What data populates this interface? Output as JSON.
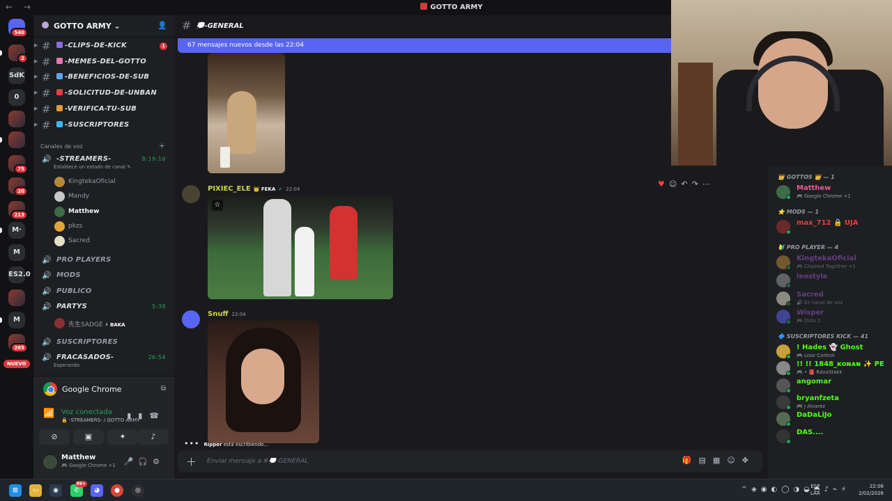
{
  "window": {
    "title": "GOTTO ARMY",
    "nav_arrows": "← →"
  },
  "server": {
    "name": "GOTTO ARMY",
    "invite_icon": "add-user-icon"
  },
  "rail": [
    {
      "label": "",
      "badge": "540",
      "icon": "discord-home-icon"
    },
    {
      "label": "",
      "badge": "2",
      "icon": "server-avatar"
    },
    {
      "label": "SdK",
      "badge": ""
    },
    {
      "label": "0",
      "badge": ""
    },
    {
      "label": "",
      "badge": "",
      "icon": "server-avatar"
    },
    {
      "label": "",
      "badge": "",
      "icon": "server-avatar"
    },
    {
      "label": "",
      "badge": "75",
      "icon": "server-avatar"
    },
    {
      "label": "",
      "badge": "20",
      "icon": "server-avatar"
    },
    {
      "label": "",
      "badge": "213",
      "icon": "server-avatar"
    },
    {
      "label": "M·",
      "badge": ""
    },
    {
      "label": "M",
      "badge": ""
    },
    {
      "label": "ES2.0",
      "badge": ""
    },
    {
      "label": "",
      "badge": "",
      "icon": "server-avatar"
    },
    {
      "label": "M",
      "badge": ""
    },
    {
      "label": "",
      "badge": "265",
      "icon": "server-avatar"
    }
  ],
  "rail_new_label": "NUEVO",
  "text_channels": [
    {
      "name": "-CLIPS-DE-KICK",
      "emoji_color": "#8a6ed8",
      "unread": "1"
    },
    {
      "name": "-MEMES-DEL-GOTTO",
      "emoji_color": "#e07ab0",
      "unread": ""
    },
    {
      "name": "-BENEFICIOS-DE-SUB",
      "emoji_color": "#5fa8e8",
      "unread": ""
    },
    {
      "name": "-SOLICITUD-DE-UNBAN",
      "emoji_color": "#e0413e",
      "unread": ""
    },
    {
      "name": "-VERIFICA-TU-SUB",
      "emoji_color": "#e39a3b",
      "unread": ""
    },
    {
      "name": "-SUSCRIPTORES",
      "emoji_color": "#3fb6e8",
      "unread": ""
    }
  ],
  "voice_category": "Canales de voz",
  "voice_channels": [
    {
      "name": "-STREAMERS-",
      "time": "8:19:16",
      "sub": "Establece un estado de canal ✎",
      "active": true
    },
    {
      "name": "PRO PLAYERS",
      "time": "",
      "sub": "",
      "active": false
    },
    {
      "name": "MODS",
      "time": "",
      "sub": "",
      "active": false
    },
    {
      "name": "PUBLICO",
      "time": "",
      "sub": "",
      "active": false
    },
    {
      "name": "PARTYS",
      "time": "5:38",
      "sub": "",
      "active": true
    },
    {
      "name": "SUSCRIPTORES",
      "time": "",
      "sub": "",
      "active": false
    },
    {
      "name": "FRACASADOS-",
      "time": "26:54",
      "sub": "Esperando",
      "active": true
    }
  ],
  "voice_members_streamers": [
    {
      "name": "KingtekaOficial",
      "color": "#b8893a",
      "me": false
    },
    {
      "name": "Mandy",
      "color": "#c7c7c7",
      "me": false
    },
    {
      "name": "Matthew",
      "color": "#3f6b48",
      "me": true
    },
    {
      "name": "pkzs",
      "color": "#e0a536",
      "me": false
    },
    {
      "name": "Sacred",
      "color": "#e6e0c9",
      "me": false
    }
  ],
  "voice_members_partys": [
    {
      "name": "先生SADGE",
      "tag": "⚡ BAKA",
      "color": "#8a3030"
    }
  ],
  "voice_panel": {
    "app_name": "Google Chrome",
    "status": "Voz conectada",
    "location": "🔒 -STREAMERS- / GOTTO ARMY"
  },
  "user": {
    "name": "Matthew",
    "status": "🎮 Google Chrome +1"
  },
  "chat": {
    "channel": "💭-GENERAL",
    "new_messages": "67 mensajes nuevos desde las 22:04",
    "messages": [
      {
        "author": "PIXIEC_ELE",
        "role_tag": "👑 FEKA",
        "time": "22:04",
        "color": "#cfd64b"
      },
      {
        "author": "Snuff",
        "role_tag": "",
        "time": "22:04",
        "color": "#cfd64b"
      }
    ],
    "typing_user": "Ripper",
    "typing_text": "está escribiendo...",
    "input_placeholder": "Enviar mensaje a #💭-GENERAL"
  },
  "member_groups": [
    {
      "title": "👑 GOTTOS 👑 — 1",
      "members": [
        {
          "name": "Matthew",
          "status": "🎮 Google Chrome +1",
          "color": "#e85c8a",
          "av": "#3f6b48",
          "off": false
        }
      ]
    },
    {
      "title": "⭐ MODS — 1",
      "members": [
        {
          "name": "max_712 🔒 UJA",
          "status": "",
          "color": "#e0413e",
          "av": "#6a2a2a",
          "off": false
        }
      ]
    },
    {
      "title": "🔰 PRO PLAYER — 4",
      "members": [
        {
          "name": "KingtekaOficial",
          "status": "🎮 Chained Together +1",
          "color": "#9b59d0",
          "av": "#b8893a",
          "off": true
        },
        {
          "name": "leostyle",
          "status": "",
          "color": "#9b59d0",
          "av": "#999",
          "off": true
        },
        {
          "name": "Sacred",
          "status": "🔊 En canal de voz",
          "color": "#9b59d0",
          "av": "#e6e0c9",
          "off": true
        },
        {
          "name": "Wisper",
          "status": "🎮 Dota 2",
          "color": "#9b59d0",
          "av": "#5865f2",
          "off": true
        }
      ]
    },
    {
      "title": "🔷 SUSCRIPTORES KICK — 41",
      "members": [
        {
          "name": "! Hades 👻 Ghost",
          "status": "🎮 Lose Control",
          "color": "#53fc18",
          "av": "#c8a03a",
          "off": false
        },
        {
          "name": "!! !! 1848_ᴋᴏɴᴀɴ ✨ PE",
          "status": "🎮 • 📕 RdxxStakk",
          "color": "#53fc18",
          "av": "#888",
          "off": false
        },
        {
          "name": "angomar",
          "status": "",
          "color": "#53fc18",
          "av": "#555",
          "off": false
        },
        {
          "name": "bryanfzeta",
          "status": "🎮 J Alvarez",
          "color": "#53fc18",
          "av": "#3a3a3a",
          "off": false
        },
        {
          "name": "DaDaLiJo",
          "status": "",
          "color": "#53fc18",
          "av": "#556b55",
          "off": false
        },
        {
          "name": "DAS....",
          "status": "",
          "color": "#53fc18",
          "av": "#333",
          "off": false
        }
      ]
    }
  ],
  "taskbar": {
    "apps": [
      "windows-start-icon",
      "file-explorer-icon",
      "steam-icon",
      "whatsapp-icon",
      "discord-icon",
      "chrome-icon",
      "obs-icon"
    ],
    "whatsapp_badge": "99+",
    "lang_line1": "ESP",
    "lang_line2": "LAA",
    "time": "22:06",
    "date": "2/02/2026"
  }
}
